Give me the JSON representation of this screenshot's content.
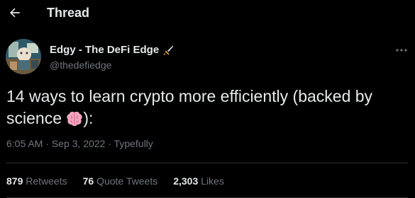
{
  "header": {
    "back_icon": "arrow-left-icon",
    "title": "Thread"
  },
  "author": {
    "display_name": "Edgy - The DeFi Edge",
    "badge_icon": "dagger-icon",
    "handle": "@thedefiedge",
    "more_icon": "more-horizontal-icon"
  },
  "tweet": {
    "text": "14 ways to learn crypto more efficiently (backed by science ",
    "emoji_icon": "brain-emoji-icon",
    "text_end": "):"
  },
  "meta": {
    "time": "6:05 AM",
    "sep1": " · ",
    "date": "Sep 3, 2022",
    "sep2": " · ",
    "source": "Typefully"
  },
  "stats": [
    {
      "count": "879",
      "label": "Retweets"
    },
    {
      "count": "76",
      "label": "Quote Tweets"
    },
    {
      "count": "2,303",
      "label": "Likes"
    }
  ],
  "colors": {
    "background": "#000000",
    "text_primary": "#e7e9ea",
    "text_secondary": "#71767b",
    "divider": "#2f3336"
  }
}
